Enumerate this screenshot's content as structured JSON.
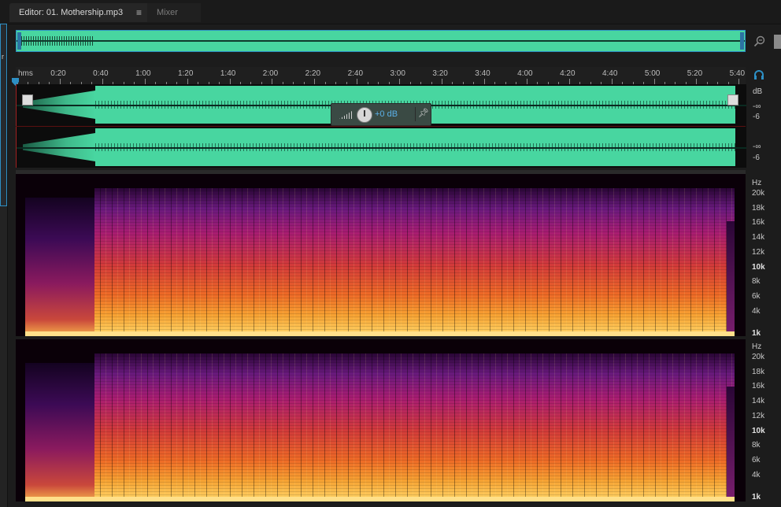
{
  "tabs": {
    "editor_label": "Editor: 01. Mothership.mp3",
    "editor_menu": "≡",
    "mixer_label": "Mixer"
  },
  "ruler": {
    "unit": "hms",
    "labels": [
      "0:20",
      "0:40",
      "1:00",
      "1:20",
      "1:40",
      "2:00",
      "2:20",
      "2:40",
      "3:00",
      "3:20",
      "3:40",
      "4:00",
      "4:20",
      "4:40",
      "5:00",
      "5:20",
      "5:40"
    ]
  },
  "hud": {
    "gain": "+0 dB"
  },
  "amplitude_scale": {
    "top": {
      "unit": "dB",
      "marks": [
        "-∞",
        "-6"
      ]
    },
    "bottom": {
      "marks": [
        "-∞",
        "-6"
      ]
    }
  },
  "frequency_scale": {
    "unit": "Hz",
    "marks": [
      "20k",
      "18k",
      "16k",
      "14k",
      "12k",
      "10k",
      "8k",
      "6k",
      "4k",
      "1k"
    ],
    "bold": [
      "10k",
      "1k"
    ]
  },
  "colors": {
    "waveform": "#48d6a0",
    "accent": "#2d8fc4",
    "gain_text": "#5bb0e8"
  },
  "left_panel": {
    "label": "r"
  }
}
